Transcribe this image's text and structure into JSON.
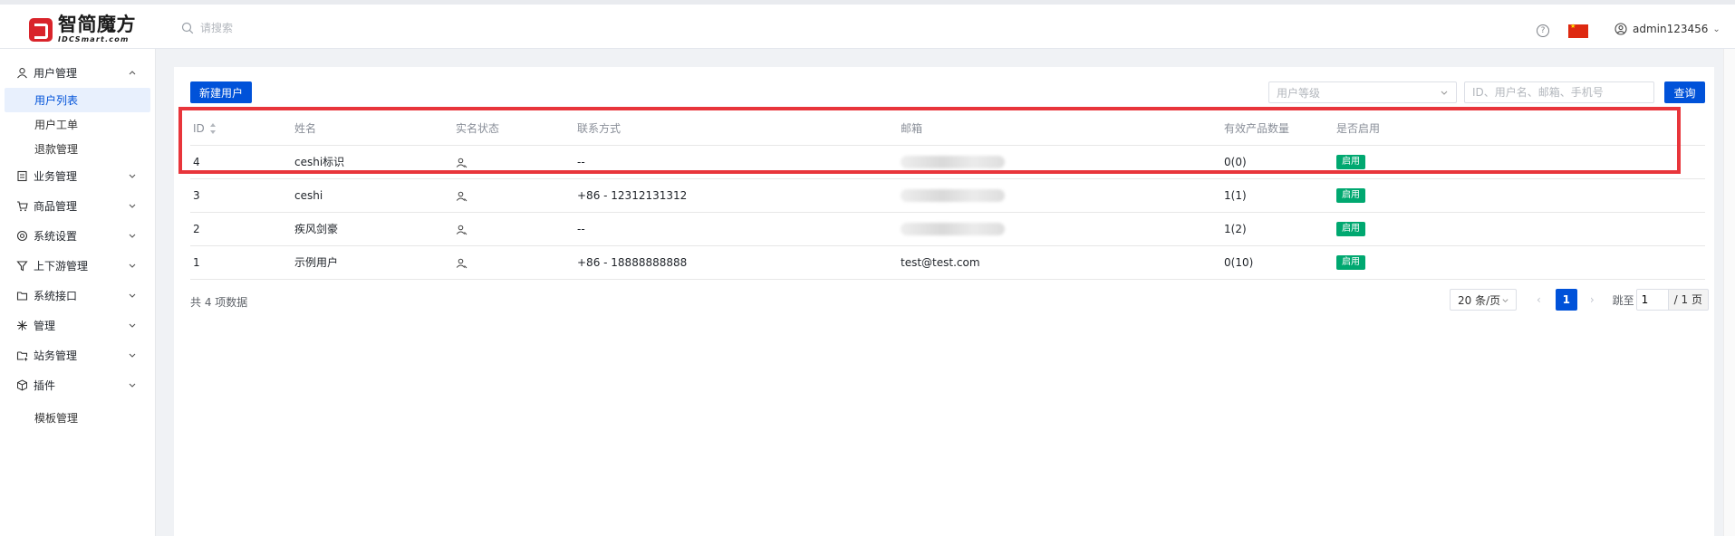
{
  "header": {
    "logo_cn": "智简魔方",
    "logo_en": "IDCSmart.com",
    "search_placeholder": "请搜索",
    "help_symbol": "?",
    "username": "admin123456"
  },
  "sidebar": {
    "groups": [
      {
        "label": "用户管理",
        "icon": "user-icon",
        "expanded": true,
        "items": [
          {
            "label": "用户列表",
            "active": true
          },
          {
            "label": "用户工单"
          },
          {
            "label": "退款管理"
          }
        ]
      },
      {
        "label": "业务管理",
        "icon": "document-icon"
      },
      {
        "label": "商品管理",
        "icon": "cart-icon"
      },
      {
        "label": "系统设置",
        "icon": "gear-icon"
      },
      {
        "label": "上下游管理",
        "icon": "filter-icon"
      },
      {
        "label": "系统接口",
        "icon": "folder-icon"
      },
      {
        "label": "管理",
        "icon": "sparkle-icon"
      },
      {
        "label": "站务管理",
        "icon": "site-icon"
      },
      {
        "label": "插件",
        "icon": "cube-icon",
        "items": [
          {
            "label": "模板管理"
          }
        ]
      }
    ]
  },
  "toolbar": {
    "new_user_label": "新建用户",
    "level_placeholder": "用户等级",
    "keyword_placeholder": "ID、用户名、邮箱、手机号",
    "query_label": "查询"
  },
  "table": {
    "columns": [
      "ID",
      "姓名",
      "实名状态",
      "联系方式",
      "邮箱",
      "有效产品数量",
      "是否启用"
    ],
    "rows": [
      {
        "id": "4",
        "name": "ceshi标识",
        "contact": "--",
        "email": "",
        "email_hidden": true,
        "products": "0(0)",
        "status": "启用"
      },
      {
        "id": "3",
        "name": "ceshi",
        "contact": "+86 - 12312131312",
        "email": "",
        "email_hidden": true,
        "products": "1(1)",
        "status": "启用"
      },
      {
        "id": "2",
        "name": "疾风剑豪",
        "contact": "--",
        "email": "",
        "email_hidden": true,
        "products": "1(2)",
        "status": "启用"
      },
      {
        "id": "1",
        "name": "示例用户",
        "contact": "+86 - 18888888888",
        "email": "test@test.com",
        "email_hidden": false,
        "products": "0(10)",
        "status": "启用"
      }
    ]
  },
  "pagination": {
    "total_text": "共 4 项数据",
    "page_size": "20 条/页",
    "current_page": "1",
    "goto_label": "跳至",
    "goto_value": "1",
    "total_pages": "/ 1 页"
  },
  "colors": {
    "primary": "#0052d9",
    "success": "#00a870",
    "highlight": "#e8353b"
  }
}
